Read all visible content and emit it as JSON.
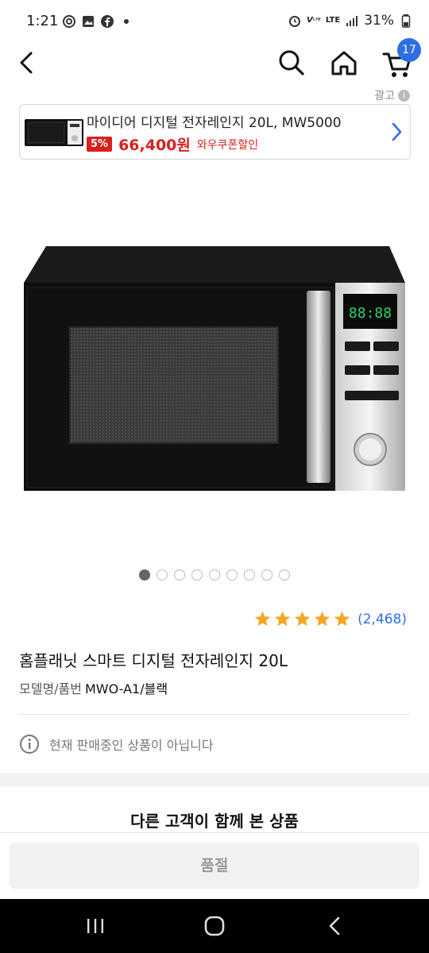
{
  "status_bar": {
    "time": "1:21",
    "left_icons": [
      "threads-icon",
      "gallery-icon",
      "facebook-icon"
    ],
    "battery": "31%",
    "network": "LTE"
  },
  "header": {
    "cart_count": "17"
  },
  "ad": {
    "label": "광고",
    "title": "마이디어 디지털 전자레인지 20L, MW5000",
    "discount": "5%",
    "price": "66,400원",
    "coupon": "와우쿠폰할인"
  },
  "gallery": {
    "total": 9,
    "active_index": 0
  },
  "rating": {
    "stars": 5,
    "count": "(2,468)"
  },
  "product": {
    "title": "홈플래닛 스마트 디지털 전자레인지 20L",
    "model_label": "모델명/품번",
    "model_value": "MWO-A1/블랙"
  },
  "notice": {
    "text": "현재 판매중인 상품이 아닙니다"
  },
  "section": {
    "title": "다른 고객이 함께 본 상품"
  },
  "bottom": {
    "soldout_label": "품절"
  },
  "colors": {
    "accent_blue": "#2f6fe6",
    "price_red": "#d9201d",
    "star_orange": "#f5a623"
  }
}
